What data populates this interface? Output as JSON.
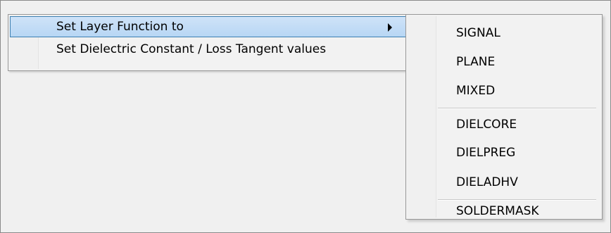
{
  "context_menu": {
    "items": [
      {
        "label": "Set Layer Function to",
        "has_submenu": true,
        "highlighted": true
      },
      {
        "label": "Set Dielectric Constant / Loss Tangent values",
        "has_submenu": false,
        "highlighted": false
      }
    ]
  },
  "submenu": {
    "groups": [
      [
        "SIGNAL",
        "PLANE",
        "MIXED"
      ],
      [
        "DIELCORE",
        "DIELPREG",
        "DIELADHV"
      ],
      [
        "SOLDERMASK"
      ]
    ]
  },
  "colors": {
    "highlight_border": "#3c7fb1",
    "highlight_fill": "#c4dcf6",
    "menu_background": "#f2f2f2"
  }
}
